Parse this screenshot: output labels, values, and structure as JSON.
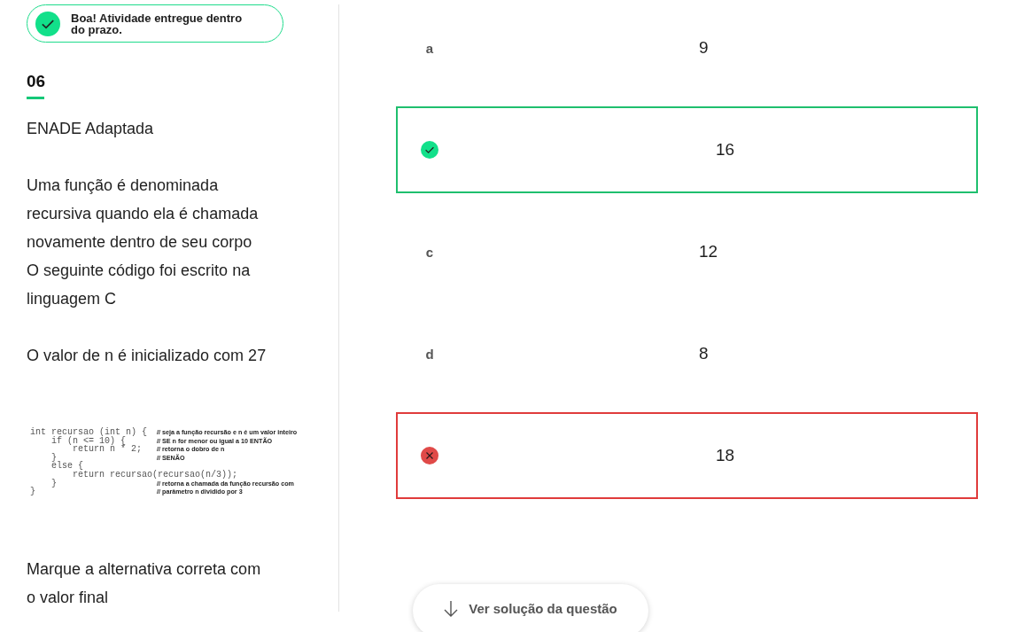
{
  "status_badge": {
    "text": "Boa! Atividade entregue dentro do prazo."
  },
  "question": {
    "number": "06",
    "source": "ENADE Adaptada",
    "statement": [
      "Uma função é denominada recursiva quando ela é chamada novamente dentro de seu corpo",
      "O seguinte código foi escrito na linguagem C"
    ],
    "initial_value_note": "O valor de n é inicializado com 27",
    "code_image": {
      "lines": [
        {
          "code": "int recursao (int n) {",
          "comment": "// seja a função recursão e n é um valor inteiro"
        },
        {
          "code": "    if (n <= 10) {",
          "comment": "// SE n for menor ou igual a 10 ENTÃO"
        },
        {
          "code": "        return n * 2;",
          "comment": "// retorna o dobro de n"
        },
        {
          "code": "    }",
          "comment": "// SENÃO"
        },
        {
          "code": "    else {"
        },
        {
          "code": "        return recursao(recursao(n/3));"
        },
        {
          "code": "    }",
          "comment": "// retorna a chamada da função recursão com"
        },
        {
          "code": "}",
          "comment": "// parâmetro n dividido por 3"
        }
      ]
    },
    "prompt": "Marque a alternativa correta com o valor final"
  },
  "options": [
    {
      "kind": "plain",
      "letter": "a",
      "value": "9"
    },
    {
      "kind": "correct",
      "value": "16"
    },
    {
      "kind": "plain",
      "letter": "c",
      "value": "12"
    },
    {
      "kind": "plain",
      "letter": "d",
      "value": "8"
    },
    {
      "kind": "wrong",
      "value": "18"
    }
  ],
  "solution_button": {
    "label": "Ver solução da questão"
  }
}
